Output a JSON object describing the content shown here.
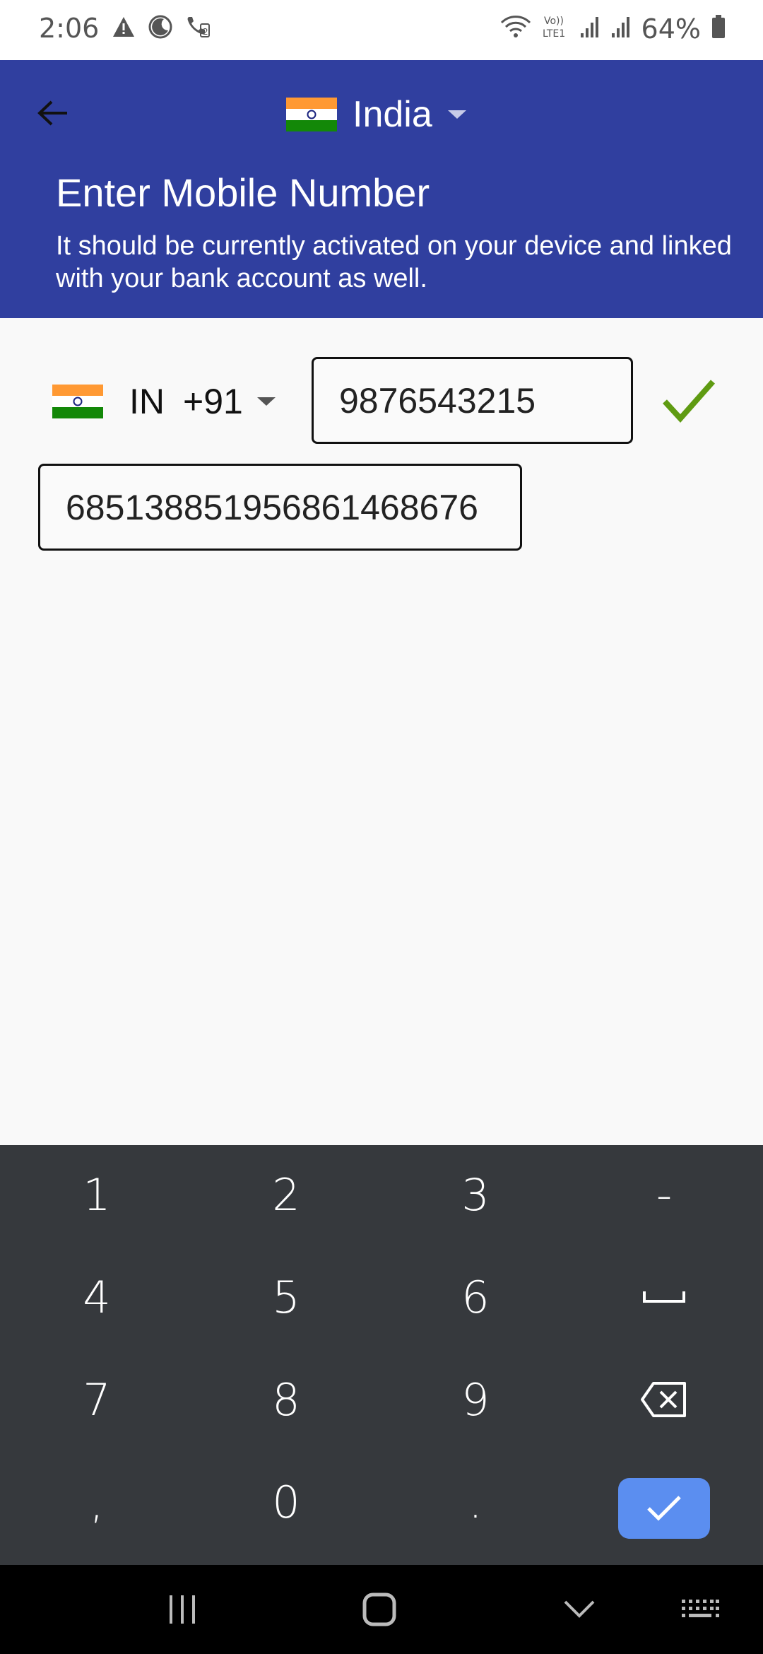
{
  "status_bar": {
    "time": "2:06",
    "battery_percent": "64%",
    "icons": [
      "alert-icon",
      "do-not-disturb-icon",
      "call-sim2-icon",
      "wifi-icon",
      "volte-lte-icon",
      "signal-sim1-icon",
      "signal-sim2-icon",
      "battery-icon"
    ]
  },
  "header": {
    "back_icon": "arrow-left-icon",
    "country": "India",
    "title": "Enter Mobile Number",
    "subtitle": "It should be currently activated on your device and linked with your bank account as well.",
    "background_color": "#303f9f"
  },
  "form": {
    "country_code": {
      "iso": "IN",
      "dial": "+91"
    },
    "phone_number": "9876543215",
    "phone_valid_icon": "checkmark-icon",
    "secondary_number": "68513885195686146867​6"
  },
  "keyboard": {
    "keys": [
      [
        "1",
        "2",
        "3",
        "-"
      ],
      [
        "4",
        "5",
        "6",
        "space"
      ],
      [
        "7",
        "8",
        "9",
        "backspace"
      ],
      [
        ",",
        "0",
        ".",
        "done"
      ]
    ],
    "done_color": "#5b8ef0"
  },
  "navbar": {
    "buttons": [
      "recents-icon",
      "home-icon",
      "hide-keyboard-icon",
      "keyboard-switch-icon"
    ]
  }
}
